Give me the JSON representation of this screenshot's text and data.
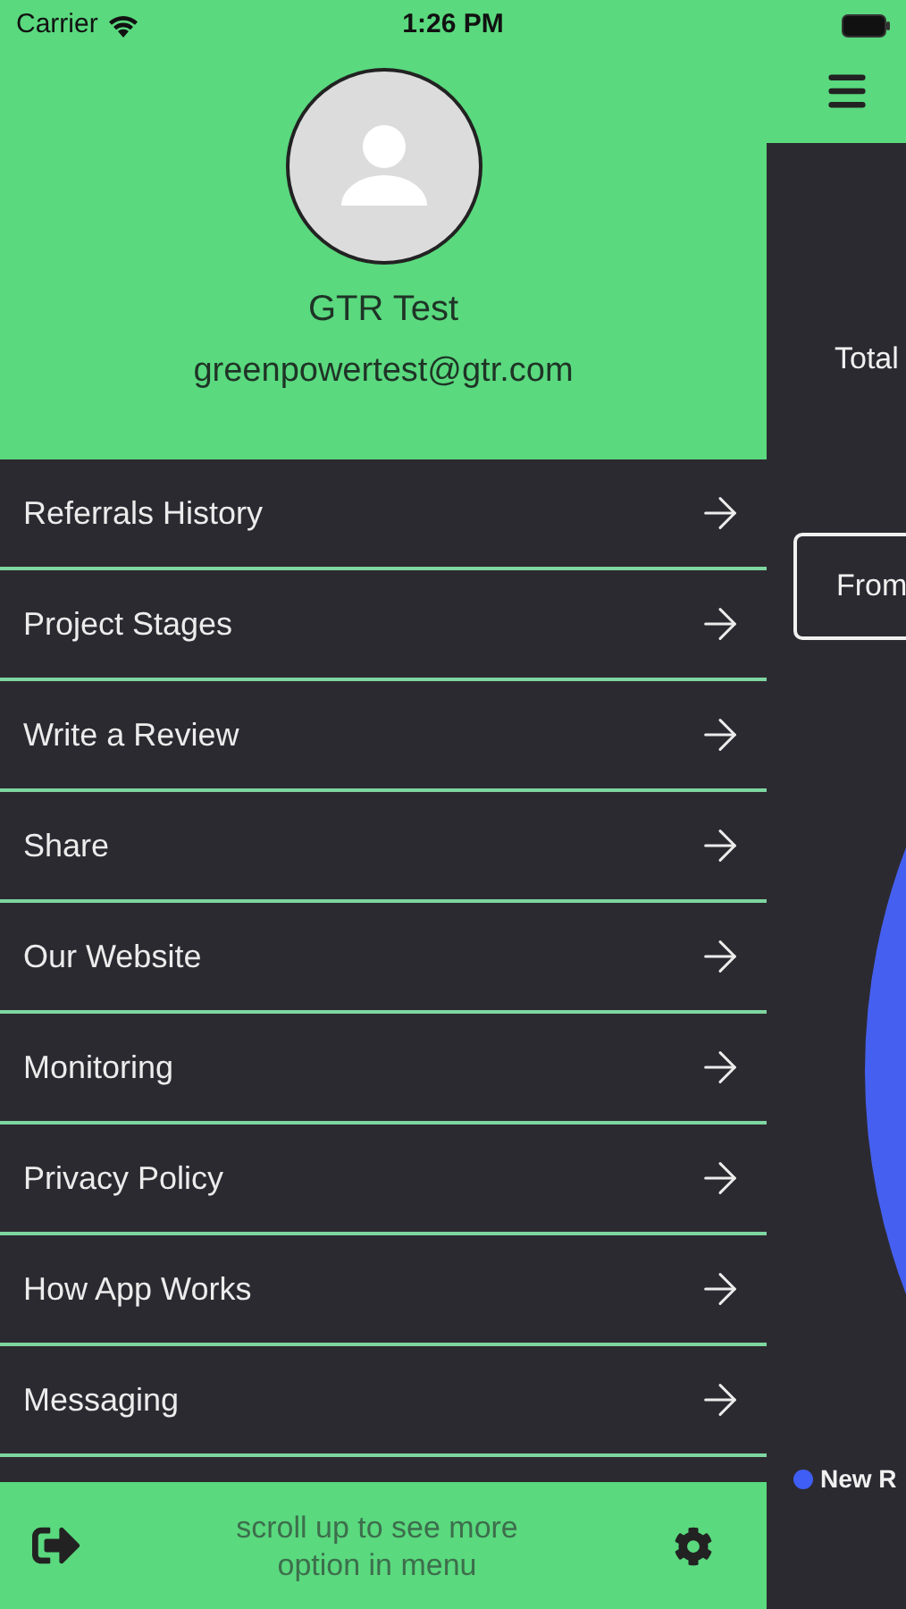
{
  "status_bar": {
    "carrier": "Carrier",
    "time": "1:26 PM"
  },
  "profile": {
    "name": "GTR Test",
    "email": "greenpowertest@gtr.com"
  },
  "menu": [
    {
      "label": "Referrals History"
    },
    {
      "label": "Project Stages"
    },
    {
      "label": "Write a Review"
    },
    {
      "label": "Share"
    },
    {
      "label": "Our Website"
    },
    {
      "label": "Monitoring"
    },
    {
      "label": "Privacy Policy"
    },
    {
      "label": "How App Works"
    },
    {
      "label": "Messaging"
    }
  ],
  "footer": {
    "hint": "scroll up to see more option in menu"
  },
  "background_screen": {
    "total_label": "Total",
    "from_button": "From",
    "legend": [
      {
        "label": "New R",
        "color": "#3f5ef5"
      }
    ]
  }
}
